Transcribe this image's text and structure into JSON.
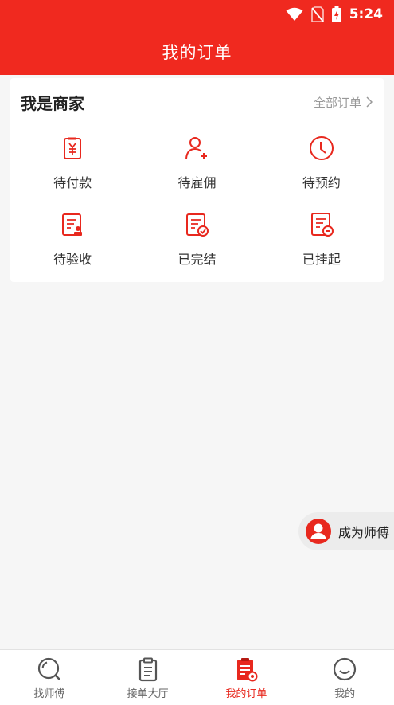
{
  "status_bar": {
    "time": "5:24"
  },
  "header": {
    "title": "我的订单"
  },
  "merchant": {
    "heading": "我是商家",
    "all_orders": "全部订单",
    "items": [
      {
        "label": "待付款",
        "icon": "payment-receipt-icon"
      },
      {
        "label": "待雇佣",
        "icon": "user-add-icon"
      },
      {
        "label": "待预约",
        "icon": "clock-icon"
      },
      {
        "label": "待验收",
        "icon": "inspection-document-icon"
      },
      {
        "label": "已完结",
        "icon": "completed-document-icon"
      },
      {
        "label": "已挂起",
        "icon": "suspended-document-icon"
      }
    ]
  },
  "fab": {
    "label": "成为师傅"
  },
  "tabbar": {
    "items": [
      {
        "label": "找师傅",
        "icon": "search-icon"
      },
      {
        "label": "接单大厅",
        "icon": "clipboard-icon"
      },
      {
        "label": "我的订单",
        "icon": "orders-icon"
      },
      {
        "label": "我的",
        "icon": "smiley-icon"
      }
    ],
    "active_index": 2
  },
  "colors": {
    "brand": "#f0291f",
    "active": "#e8281e",
    "inactive": "#555555"
  }
}
